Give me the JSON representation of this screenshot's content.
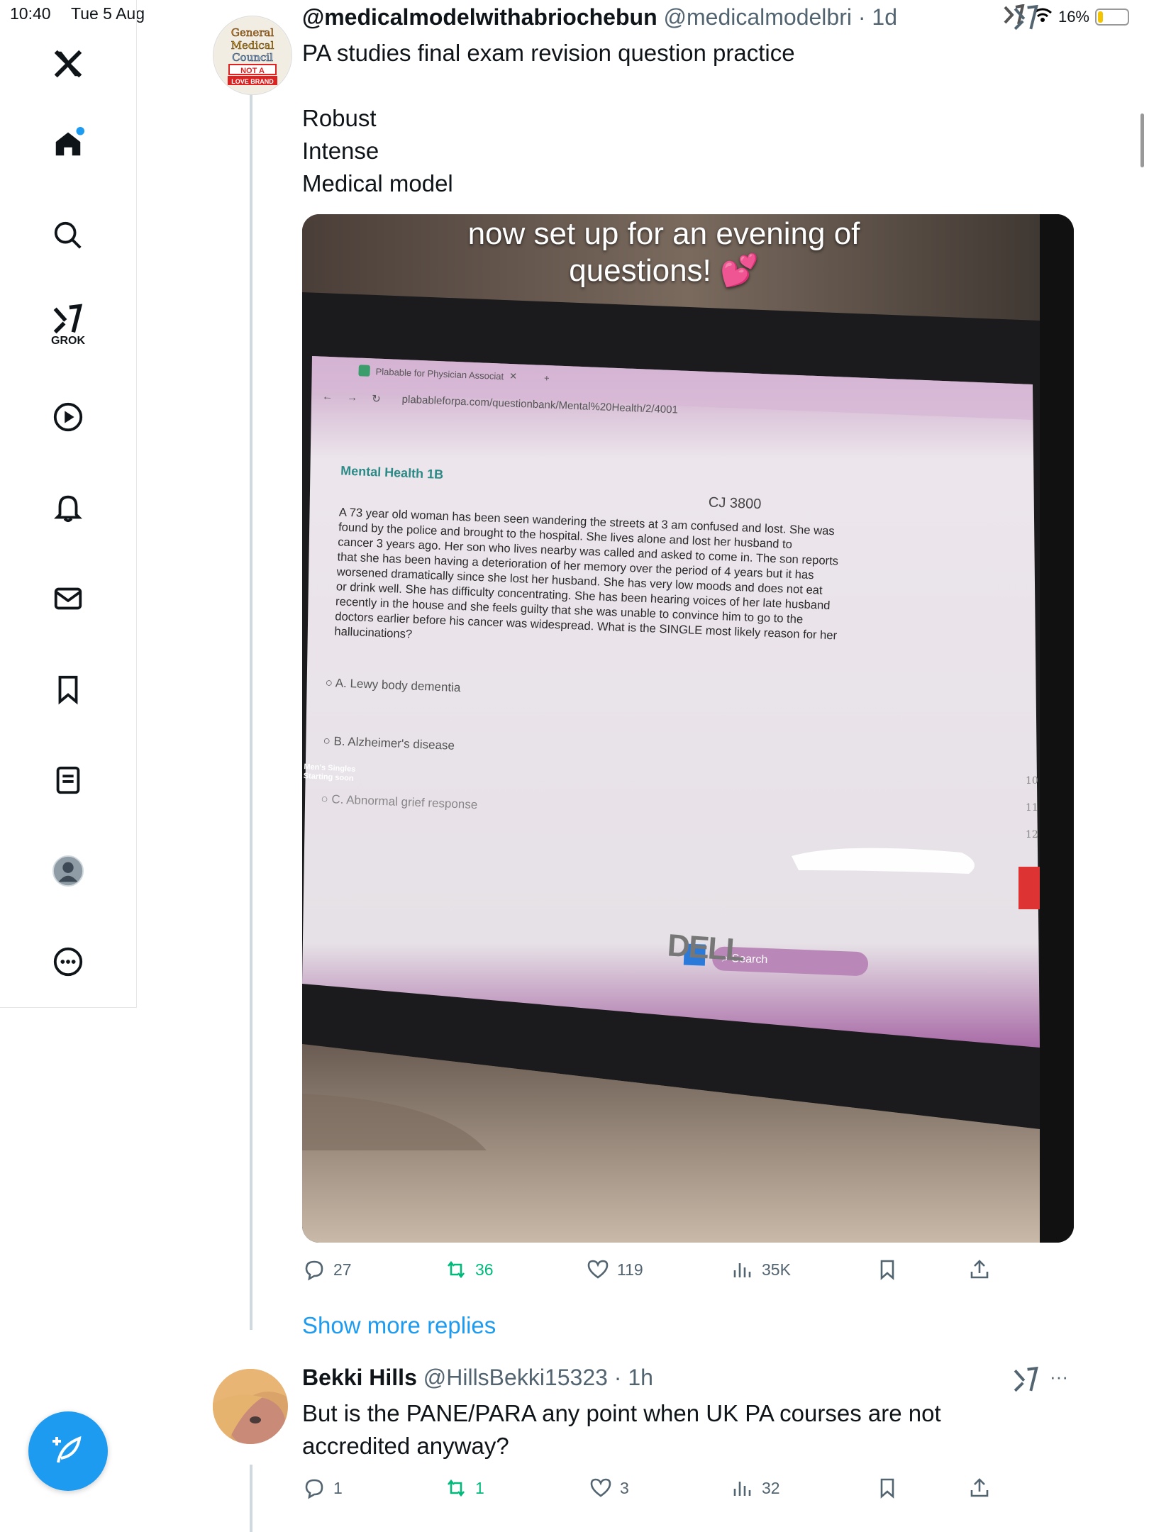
{
  "status_bar": {
    "time": "10:40",
    "date": "Tue 5 Aug",
    "battery": "16%",
    "battery_level": 0.16
  },
  "sidebar": {
    "items": [
      {
        "icon": "x-logo-icon"
      },
      {
        "icon": "home-icon"
      },
      {
        "icon": "search-icon"
      },
      {
        "icon": "grok-icon",
        "label": "GROK"
      },
      {
        "icon": "play-icon"
      },
      {
        "icon": "bell-icon"
      },
      {
        "icon": "mail-icon"
      },
      {
        "icon": "bookmark-icon"
      },
      {
        "icon": "list-icon"
      },
      {
        "icon": "profile-icon"
      },
      {
        "icon": "more-icon"
      }
    ],
    "compose_icon": "compose-icon"
  },
  "tweet": {
    "display_name": "@medicalmodelwithabriochebun",
    "handle": "@medicalmodelbri",
    "time": "· 1d",
    "line1": "PA studies final exam revision question practice",
    "line2": "Robust",
    "line3": "Intense",
    "line4": "Medical model",
    "avatar_text": [
      "General",
      "Medical",
      "Council",
      "NOT A",
      "LOVE BRAND"
    ],
    "media": {
      "caption_line1": "now set up for an evening of",
      "caption_line2": "questions! 💕",
      "browser_tab": "Plabable for Physician Associat",
      "url": "plabableforpa.com/questionbank/Mental%20Health/2/4001",
      "section": "Mental Health 1B",
      "question_id": "CJ 3800",
      "question_lines": [
        "A 73 year old woman has been seen wandering the streets at 3 am confused and lost. She was",
        "found by the police and brought to the hospital. She lives alone and lost her husband to",
        "cancer 3 years ago. Her son who lives nearby was called and asked to come in. The son reports",
        "that she has been having a deterioration of her memory over the period of 4 years but it has",
        "worsened dramatically since she lost her husband. She has very low moods and does not eat",
        "or drink well. She has difficulty concentrating. She has been hearing voices of her late husband",
        "recently in the house and she feels guilty that she was unable to convince him to go to the",
        "doctors earlier before his cancer was widespread. What is the SINGLE most likely reason for her",
        "hallucinations?"
      ],
      "options": [
        "A.  Lewy body dementia",
        "B.  Alzheimer's disease",
        "C.  Abnormal grief response"
      ],
      "taskbar_search": "Search",
      "tv_text1": "Men's Singles",
      "tv_text2": "Starting soon",
      "brand": "DELL",
      "side_nums": [
        "10",
        "11",
        "12"
      ]
    },
    "actions": {
      "replies": "27",
      "reposts": "36",
      "likes": "119",
      "views": "35K"
    }
  },
  "show_more": "Show more replies",
  "reply": {
    "display_name": "Bekki Hills",
    "handle": "@HillsBekki15323",
    "time": "· 1h",
    "line1": "But is the PANE/PARA any point when UK PA courses are not",
    "line2": "accredited anyway?",
    "actions": {
      "replies": "1",
      "reposts": "1",
      "likes": "3",
      "views": "32"
    }
  }
}
